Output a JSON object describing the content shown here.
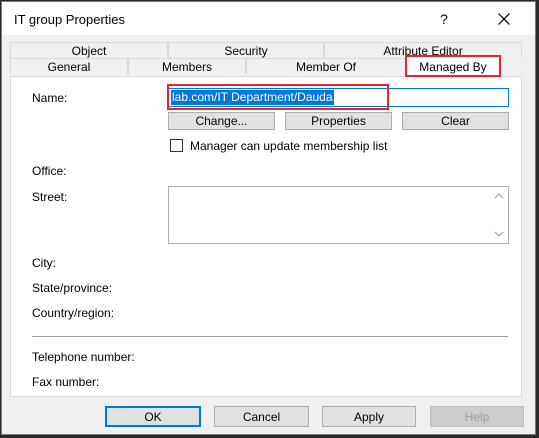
{
  "window": {
    "title": "IT group Properties",
    "help_label": "?"
  },
  "tabs": {
    "object": "Object",
    "security": "Security",
    "attribute_editor": "Attribute Editor",
    "general": "General",
    "members": "Members",
    "member_of": "Member Of",
    "managed_by": "Managed By"
  },
  "form": {
    "name_label": "Name:",
    "name_value": "lab.com/IT Department/Dauda",
    "change_button": "Change...",
    "properties_button": "Properties",
    "clear_button": "Clear",
    "checkbox_label": "Manager can update membership list",
    "checkbox_checked": false,
    "office_label": "Office:",
    "street_label": "Street:",
    "city_label": "City:",
    "state_label": "State/province:",
    "country_label": "Country/region:",
    "telephone_label": "Telephone number:",
    "fax_label": "Fax number:"
  },
  "footer": {
    "ok": "OK",
    "cancel": "Cancel",
    "apply": "Apply",
    "help": "Help"
  },
  "colors": {
    "selection": "#0078d7",
    "annotation": "#e8242c"
  }
}
